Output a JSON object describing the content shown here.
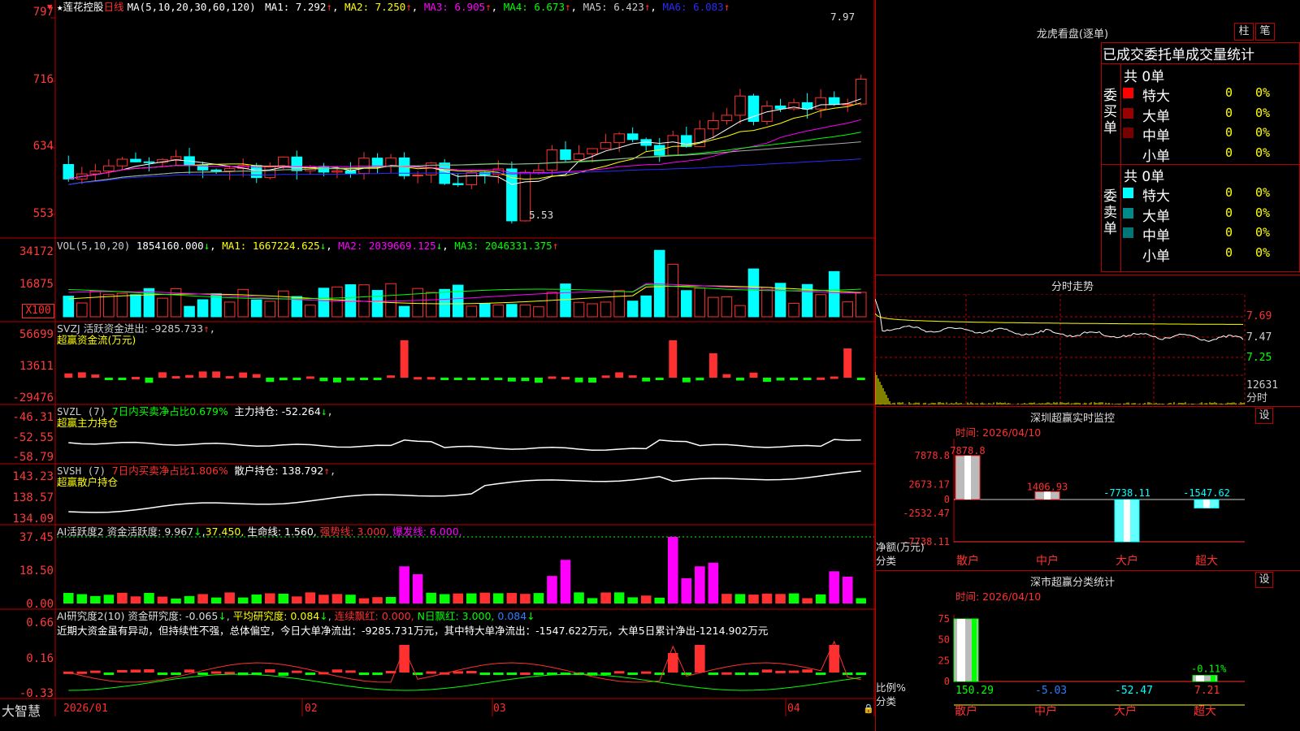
{
  "app": {
    "logo": "大智慧"
  },
  "main": {
    "stock_name": "莲花控股",
    "period": "日线",
    "ma_header": "MA(5,10,20,30,60,120)",
    "ma": [
      {
        "label": "MA1: 7.292",
        "color": "#ffffff"
      },
      {
        "label": "MA2: 7.250",
        "color": "#ffff00"
      },
      {
        "label": "MA3: 6.905",
        "color": "#ff00ff"
      },
      {
        "label": "MA4: 6.673",
        "color": "#00ff00"
      },
      {
        "label": "MA5: 6.423",
        "color": "#cccccc"
      },
      {
        "label": "MA6: 6.083",
        "color": "#2222ff"
      }
    ],
    "y_ticks": [
      "797",
      "716",
      "634",
      "553"
    ],
    "high_label": "7.97",
    "low_label": "5.53"
  },
  "vol": {
    "header": "VOL(5,10,20)",
    "value": "1854160.000",
    "ma1": "MA1: 1667224.625",
    "ma2": "MA2: 2039669.125",
    "ma3": "MA3: 2046331.375",
    "y_ticks": [
      "34172",
      "16875"
    ],
    "unit": "X100"
  },
  "svzj": {
    "header": "SVZJ  活跃资金进出: -9285.733",
    "sub": "超赢资金流(万元)",
    "y_ticks": [
      "56699",
      "13611",
      "-29476"
    ]
  },
  "svzl": {
    "header_a": "SVZL (7)",
    "header_b": "7日内买卖净占比0.679%",
    "header_c": "主力持仓: -52.264",
    "sub": "超赢主力持仓",
    "y_ticks": [
      "-46.31",
      "-52.55",
      "-58.79"
    ]
  },
  "svsh": {
    "header_a": "SVSH (7)",
    "header_b": "7日内买卖净占比1.806%",
    "header_c": "散户持仓: 138.792",
    "sub": "超赢散户持仓",
    "y_ticks": [
      "143.23",
      "138.57",
      "134.09"
    ]
  },
  "ai_active": {
    "header_a": "AI活跃度2 资金活跃度: 9.967",
    "header_b": "37.450,",
    "header_c": "生命线: 1.560,",
    "header_d": "强势线: 3.000,",
    "header_e": "爆发线: 6.000,",
    "y_ticks": [
      "37.45",
      "18.50",
      "0.00"
    ]
  },
  "ai_research": {
    "header_a": "AI研究度2(10) 资金研究度: -0.065",
    "header_b": "平均研究度: 0.084",
    "header_c": "连续飘红: 0.000,",
    "header_d": "N日飘红: 3.000,",
    "header_e": "0.084",
    "comment": "近期大资金虽有异动，但持续性不强，总体偏空，今日大单净流出：-9285.731万元，其中特大单净流出：-1547.622万元，大单5日累计净出-1214.902万元",
    "y_ticks": [
      "0.66",
      "0.16",
      "-0.33"
    ]
  },
  "x_axis": [
    "2026/01",
    "02",
    "03",
    "04"
  ],
  "dragon": {
    "title": "龙虎看盘(逐单)",
    "btn_zhu": "柱",
    "btn_bi": "笔",
    "header": "已成交委托单成交量统计",
    "buy": {
      "label": "委买单",
      "total": "共 0单",
      "rows": [
        {
          "name": "特大",
          "val": "0",
          "pct": "0%",
          "color": "#ff0000"
        },
        {
          "name": "大单",
          "val": "0",
          "pct": "0%",
          "color": "#990000"
        },
        {
          "name": "中单",
          "val": "0",
          "pct": "0%",
          "color": "#770000"
        },
        {
          "name": "小单",
          "val": "0",
          "pct": "0%",
          "color": "#000000"
        }
      ]
    },
    "sell": {
      "label": "委卖单",
      "total": "共 0单",
      "rows": [
        {
          "name": "特大",
          "val": "0",
          "pct": "0%",
          "color": "#00ffff"
        },
        {
          "name": "大单",
          "val": "0",
          "pct": "0%",
          "color": "#008b8b"
        },
        {
          "name": "中单",
          "val": "0",
          "pct": "0%",
          "color": "#007777"
        },
        {
          "name": "小单",
          "val": "0",
          "pct": "0%",
          "color": "#000000"
        }
      ]
    }
  },
  "intraday": {
    "title": "分时走势",
    "y_ticks": [
      "7.69",
      "7.47",
      "7.25"
    ],
    "vol_label": "12631",
    "vol_unit": "分时"
  },
  "sz_monitor": {
    "title": "深圳超赢实时监控",
    "time": "时间: 2026/04/10",
    "settings": "设",
    "y_ticks": [
      "7878.8",
      "2673.17",
      "0",
      "-2532.47",
      "-7738.11"
    ],
    "ylabel": "净额(万元)",
    "xlabel": "分类",
    "chart_data": {
      "type": "bar",
      "categories": [
        "散户",
        "中户",
        "大户",
        "超大"
      ],
      "values": [
        7878.8,
        1406.93,
        -7738.11,
        -1547.62
      ],
      "value_labels": [
        "7878.8",
        "1406.93",
        "-7738.11",
        "-1547.62"
      ],
      "ylim": [
        -7738.11,
        7878.8
      ]
    }
  },
  "sz_class": {
    "title": "深市超赢分类统计",
    "time": "时间: 2026/04/10",
    "settings": "设",
    "y_ticks": [
      "75",
      "50",
      "25",
      "0"
    ],
    "ylabel": "比例%",
    "xlabel": "分类",
    "chart_data": {
      "type": "bar",
      "categories": [
        "散户",
        "中户",
        "大户",
        "超大"
      ],
      "values": [
        150.29,
        -5.03,
        -52.47,
        7.21
      ],
      "value_labels": [
        "150.29",
        "-5.03",
        "-52.47",
        "7.21"
      ],
      "top_label": "-0.11%",
      "ylim": [
        0,
        75
      ]
    }
  }
}
